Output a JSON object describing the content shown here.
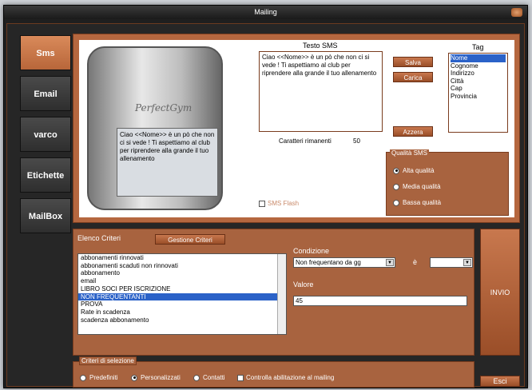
{
  "window": {
    "title": "Mailing"
  },
  "nav": {
    "items": [
      {
        "label": "Sms",
        "active": true
      },
      {
        "label": "Email",
        "active": false
      },
      {
        "label": "varco",
        "active": false
      },
      {
        "label": "Etichette",
        "active": false
      },
      {
        "label": "MailBox",
        "active": false
      }
    ]
  },
  "sms": {
    "brand": "PerfectGym",
    "text_label": "Testo SMS",
    "text": "Ciao <<Nome>> è un pò che non ci si vede ! Ti aspettiamo al club per riprendere alla grande il tuo allenamento",
    "chars_label": "Caratteri rimanenti",
    "chars_value": "50",
    "save_label": "Salva",
    "load_label": "Carica",
    "reset_label": "Azzera",
    "flash_label": "SMS Flash",
    "tag_label": "Tag",
    "tags": [
      "Nome",
      "Cognome",
      "Indirizzo",
      "Città",
      "Cap",
      "Provincia"
    ],
    "tag_selected": "Nome",
    "quality_label": "Qualità SMS",
    "quality_options": [
      "Alta qualità",
      "Media qualità",
      "Bassa qualità"
    ],
    "quality_selected": "Alta qualità"
  },
  "criteria": {
    "list_label": "Elenco Criteri",
    "manage_label": "Gestione Criteri",
    "items": [
      "abbonamenti rinnovati",
      "abbonamenti scaduti non rinnovati",
      "abbonamento",
      "email",
      "LIBRO SOCI PER ISCRIZIONE",
      "NON FREQUENTANTI",
      "PROVA",
      "Rate in scadenza",
      "scadenza abbonamento"
    ],
    "selected": "NON FREQUENTANTI",
    "condition_label": "Condizione",
    "condition_value": "Non frequentano da gg",
    "operator_label": "è",
    "operator_value": "",
    "value_label": "Valore",
    "value": "45"
  },
  "send_label": "INVIO",
  "selection": {
    "label": "Criteri di selezione",
    "options": [
      "Predefiniti",
      "Personalizzati",
      "Contatti"
    ],
    "selected": "Personalizzati",
    "check_label": "Controlla abilitazione al mailing"
  },
  "exit_label": "Esci"
}
